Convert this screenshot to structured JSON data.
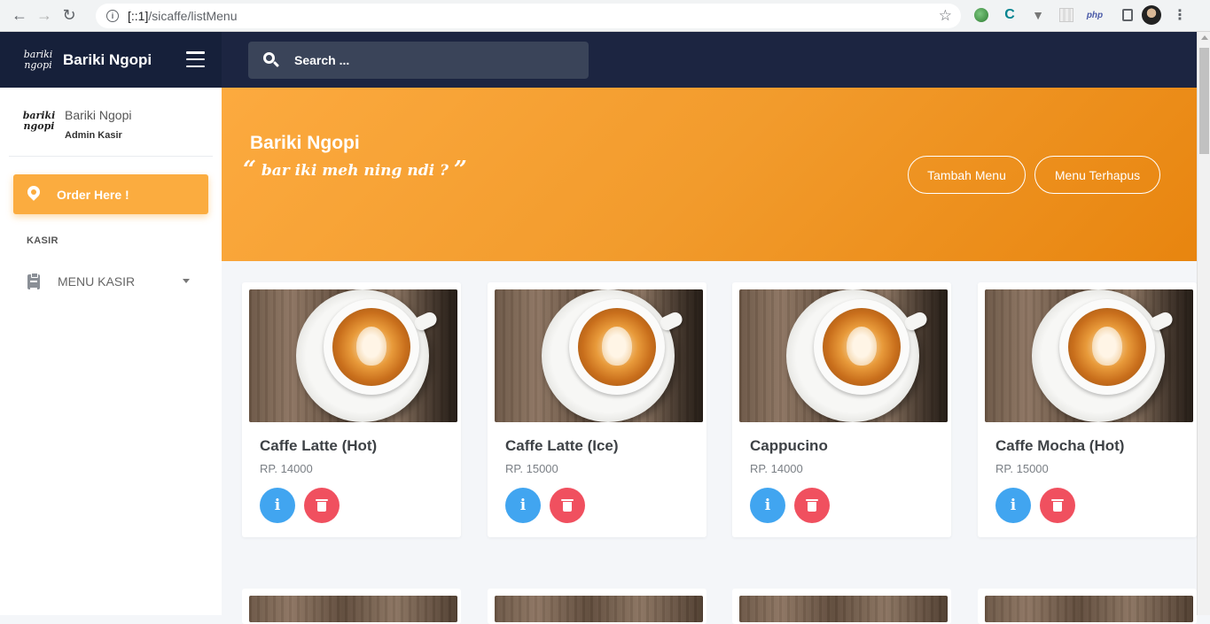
{
  "browser": {
    "url_host": "[::1]",
    "url_path": "/sicaffe/listMenu",
    "ext_php": "php"
  },
  "app": {
    "brand_name": "Bariki Ngopi",
    "logo_text_line1": "bariki",
    "logo_text_line2": "ngopi",
    "search_placeholder": "Search ..."
  },
  "sidebar": {
    "profile_name": "Bariki Ngopi",
    "profile_role": "Admin Kasir",
    "order_button": "Order Here !",
    "section_label": "KASIR",
    "menu_item": "MENU KASIR"
  },
  "hero": {
    "title": "Bariki Ngopi",
    "quote_open": "“",
    "quote_text": "bar iki meh ning ndi ?",
    "quote_close": "”",
    "btn_add": "Tambah Menu",
    "btn_deleted": "Menu Terhapus"
  },
  "menu_items": [
    {
      "name": "Caffe Latte (Hot)",
      "price": "RP. 14000"
    },
    {
      "name": "Caffe Latte (Ice)",
      "price": "RP. 15000"
    },
    {
      "name": "Cappucino",
      "price": "RP. 14000"
    },
    {
      "name": "Caffe Mocha (Hot)",
      "price": "RP. 15000"
    }
  ],
  "icons": {
    "info_glyph": "i"
  },
  "colors": {
    "topbar": "#1c2541",
    "accent_orange": "#fbac3f",
    "info_blue": "#41a5f0",
    "delete_red": "#f0505f"
  }
}
